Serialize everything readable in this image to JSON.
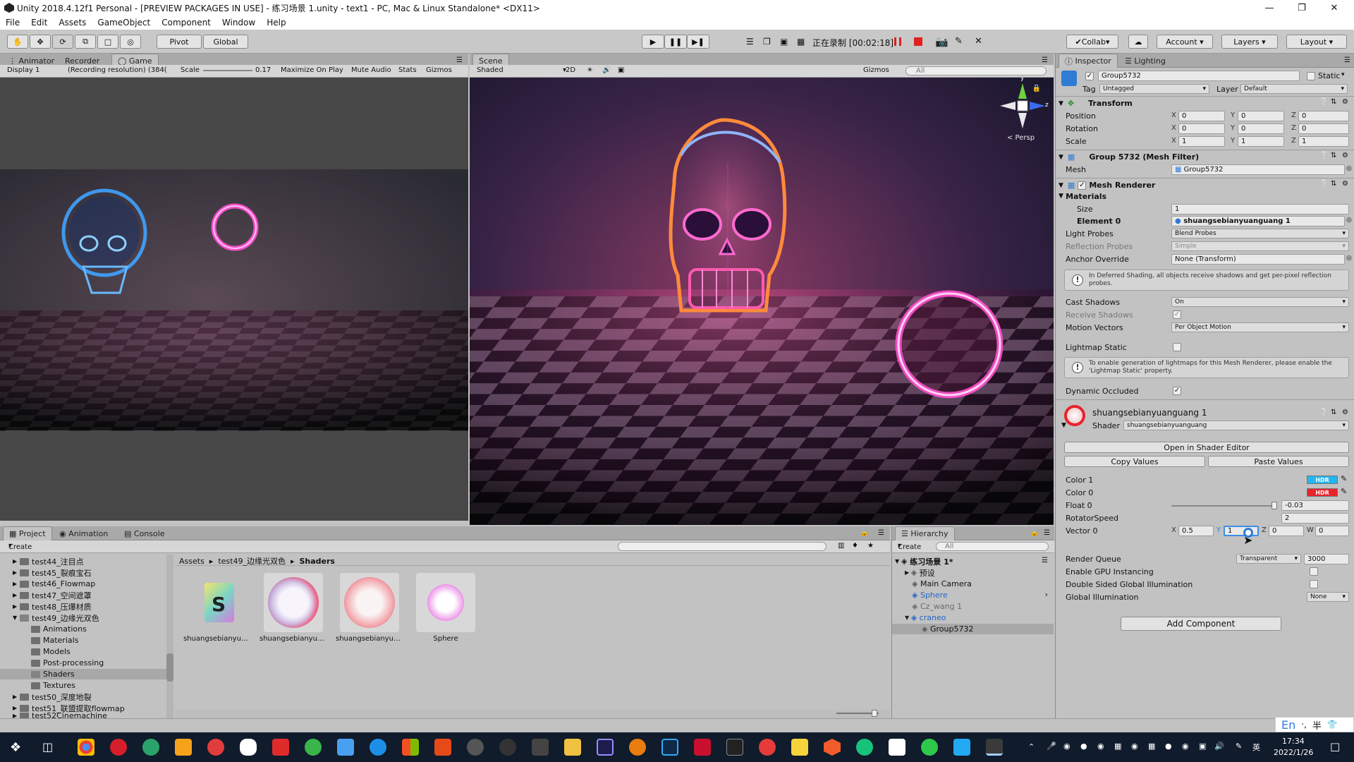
{
  "window": {
    "title": "Unity 2018.4.12f1 Personal - [PREVIEW PACKAGES IN USE] - 练习场景 1.unity - text1 - PC, Mac & Linux Standalone* <DX11>"
  },
  "menu": [
    "File",
    "Edit",
    "Assets",
    "GameObject",
    "Component",
    "Window",
    "Help"
  ],
  "toolbar": {
    "pivot": "Pivot",
    "global": "Global",
    "recording": "正在录制 [00:02:18]",
    "collab": "Collab",
    "account": "Account",
    "layers": "Layers",
    "layout": "Layout"
  },
  "game": {
    "tabs": [
      "Animator",
      "Recorder",
      "Game"
    ],
    "display": "Display 1",
    "resolution": "(Recording resolution) (384(",
    "scale_label": "Scale",
    "scale_value": "0.17",
    "maximize": "Maximize On Play",
    "mute": "Mute Audio",
    "stats": "Stats",
    "gizmos": "Gizmos"
  },
  "scene": {
    "tab": "Scene",
    "shading": "Shaded",
    "mode": "2D",
    "gizmos": "Gizmos",
    "search": "All",
    "persp": "< Persp",
    "axis_y": "y",
    "axis_z": "z"
  },
  "inspector": {
    "tabs": [
      "Inspector",
      "Lighting"
    ],
    "object_name": "Group5732",
    "static": "Static",
    "tag_label": "Tag",
    "tag_value": "Untagged",
    "layer_label": "Layer",
    "layer_value": "Default",
    "transform": {
      "title": "Transform",
      "rows": [
        {
          "label": "Position",
          "x": "0",
          "y": "0",
          "z": "0"
        },
        {
          "label": "Rotation",
          "x": "0",
          "y": "0",
          "z": "0"
        },
        {
          "label": "Scale",
          "x": "1",
          "y": "1",
          "z": "1"
        }
      ]
    },
    "mesh_filter": {
      "title": "Group 5732 (Mesh Filter)",
      "mesh_label": "Mesh",
      "mesh_value": "Group5732"
    },
    "mesh_renderer": {
      "title": "Mesh Renderer",
      "materials": "Materials",
      "size_label": "Size",
      "size_value": "1",
      "element_label": "Element 0",
      "element_value": "shuangsebianyuanguang 1",
      "light_probes_label": "Light Probes",
      "light_probes_value": "Blend Probes",
      "reflection_label": "Reflection Probes",
      "reflection_value": "Simple",
      "anchor_label": "Anchor Override",
      "anchor_value": "None (Transform)",
      "deferred_note": "In Deferred Shading, all objects receive shadows and get per-pixel reflection probes.",
      "cast_label": "Cast Shadows",
      "cast_value": "On",
      "receive_label": "Receive Shadows",
      "motion_label": "Motion Vectors",
      "motion_value": "Per Object Motion",
      "lightmap_label": "Lightmap Static",
      "lightmap_note": "To enable generation of lightmaps for this Mesh Renderer, please enable the 'Lightmap Static' property.",
      "occluded_label": "Dynamic Occluded"
    },
    "material": {
      "name": "shuangsebianyuanguang 1",
      "shader_label": "Shader",
      "shader_value": "shuangsebianyuanguang",
      "open_editor": "Open in Shader Editor",
      "copy": "Copy Values",
      "paste": "Paste Values",
      "color1_label": "Color 1",
      "color0_label": "Color 0",
      "hdr": "HDR",
      "color1": "#23b6f0",
      "color0": "#e8232b",
      "float0_label": "Float 0",
      "float0_value": "-0.03",
      "rotator_label": "RotatorSpeed",
      "rotator_value": "2",
      "vector0_label": "Vector 0",
      "vx": "0.5",
      "vy": "1",
      "vz": "0",
      "vw": "0",
      "render_queue_label": "Render Queue",
      "render_queue_mode": "Transparent",
      "render_queue_value": "3000",
      "gpu_label": "Enable GPU Instancing",
      "double_label": "Double Sided Global Illumination",
      "gi_label": "Global Illumination",
      "gi_value": "None"
    },
    "add_component": "Add Component"
  },
  "project": {
    "tabs": [
      "Project",
      "Animation",
      "Console"
    ],
    "create": "Create",
    "tree": [
      {
        "label": "test44_注目点",
        "indent": 0
      },
      {
        "label": "test45_裂痕宝石",
        "indent": 0
      },
      {
        "label": "test46_Flowmap",
        "indent": 0
      },
      {
        "label": "test47_空间遮罩",
        "indent": 0
      },
      {
        "label": "test48_压爆材质",
        "indent": 0
      },
      {
        "label": "test49_边缘光双色",
        "indent": 0
      },
      {
        "label": "Animations",
        "indent": 1
      },
      {
        "label": "Materials",
        "indent": 1
      },
      {
        "label": "Models",
        "indent": 1
      },
      {
        "label": "Post-processing",
        "indent": 1
      },
      {
        "label": "Shaders",
        "indent": 1
      },
      {
        "label": "Textures",
        "indent": 1
      },
      {
        "label": "test50_深度地裂",
        "indent": 0
      },
      {
        "label": "test51_联盟提取flowmap",
        "indent": 0
      },
      {
        "label": "test52Cinemachine",
        "indent": 0
      }
    ],
    "breadcrumb": [
      "Assets",
      "test49_边缘光双色",
      "Shaders"
    ],
    "assets": [
      "shuangsebianyua...",
      "shuangsebianyua...",
      "shuangsebianyua...",
      "Sphere"
    ]
  },
  "hierarchy": {
    "tab": "Hierarchy",
    "create": "Create",
    "search": "All",
    "scene": "练习场景 1*",
    "items": [
      {
        "label": "预设",
        "indent": 1
      },
      {
        "label": "Main Camera",
        "indent": 1
      },
      {
        "label": "Sphere",
        "indent": 1
      },
      {
        "label": "Cz_wang 1",
        "indent": 1
      },
      {
        "label": "craneo",
        "indent": 1
      },
      {
        "label": "Group5732",
        "indent": 2
      }
    ]
  },
  "taskbar": {
    "ime": "En",
    "ime2": "半",
    "time": "17:34",
    "date": "2022/1/26",
    "lang": "英"
  }
}
